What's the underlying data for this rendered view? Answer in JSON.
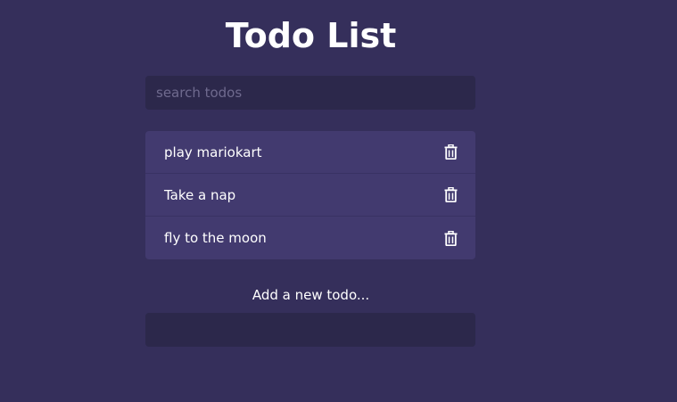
{
  "header": {
    "title": "Todo List"
  },
  "search": {
    "placeholder": "search todos",
    "value": ""
  },
  "todos": [
    {
      "text": "play mariokart",
      "icon": "trash-icon"
    },
    {
      "text": "Take a nap",
      "icon": "trash-icon"
    },
    {
      "text": "fly to the moon",
      "icon": "trash-icon"
    }
  ],
  "add_form": {
    "label": "Add a new todo...",
    "value": ""
  },
  "colors": {
    "background": "#352f5b",
    "input_background": "#2c284b",
    "item_background": "#423a6f",
    "text": "#ffffff",
    "placeholder": "#6f6a8e"
  }
}
